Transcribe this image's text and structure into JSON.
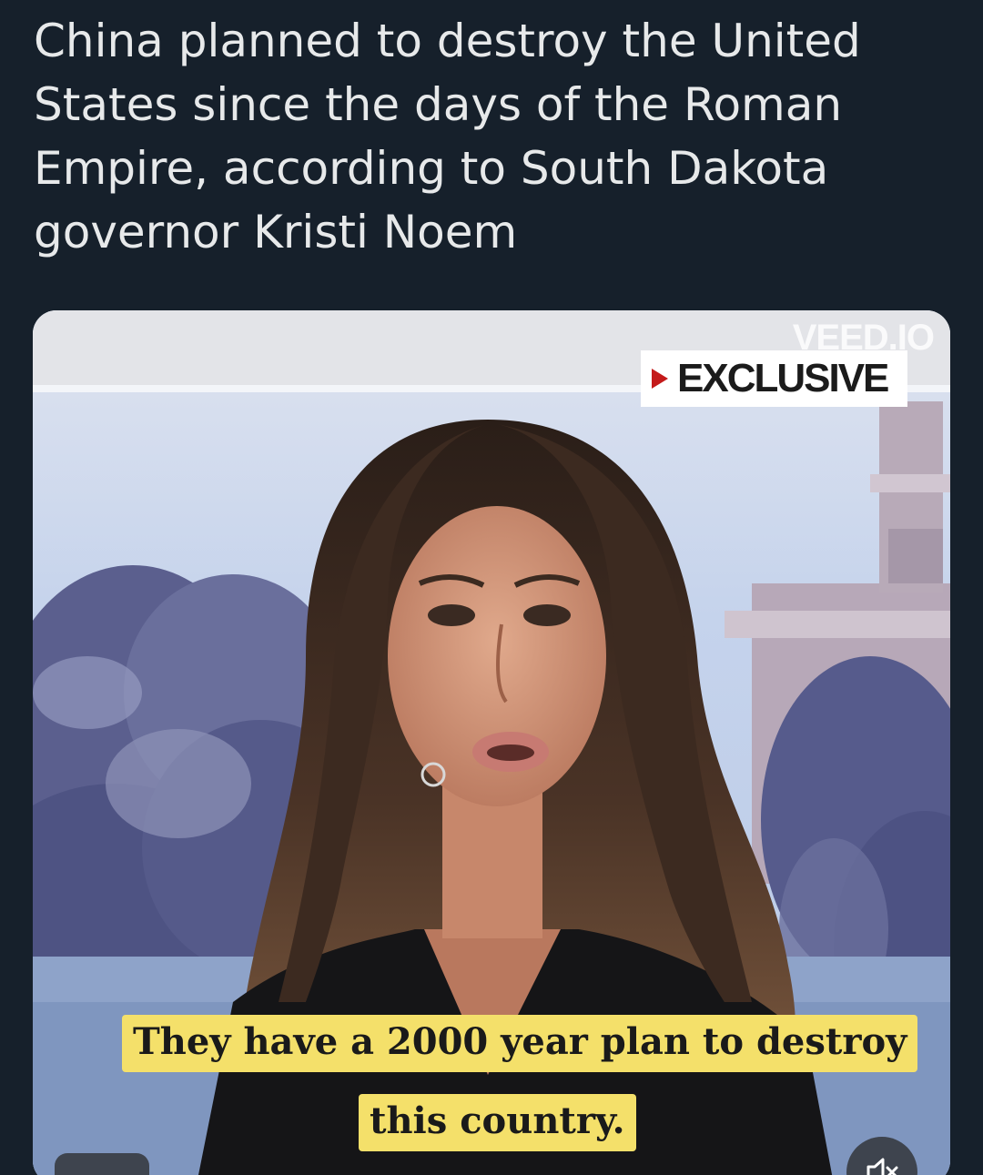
{
  "tweet": {
    "text_lines": [
      "China planned to destroy the United",
      "States since the days of the Roman",
      "Empire, according to South Dakota",
      "governor Kristi Noem"
    ]
  },
  "video": {
    "watermark": "VEED.IO",
    "tag_label": "EXCLUSIVE",
    "caption_line_1": "They have a 2000 year plan to destroy",
    "caption_line_2": "this country.",
    "mute_icon": "speaker-muted-icon"
  },
  "colors": {
    "background": "#16202b",
    "text": "#e7e9ea",
    "caption_bg": "#f4e06a",
    "tag_arrow": "#c41a1a"
  }
}
